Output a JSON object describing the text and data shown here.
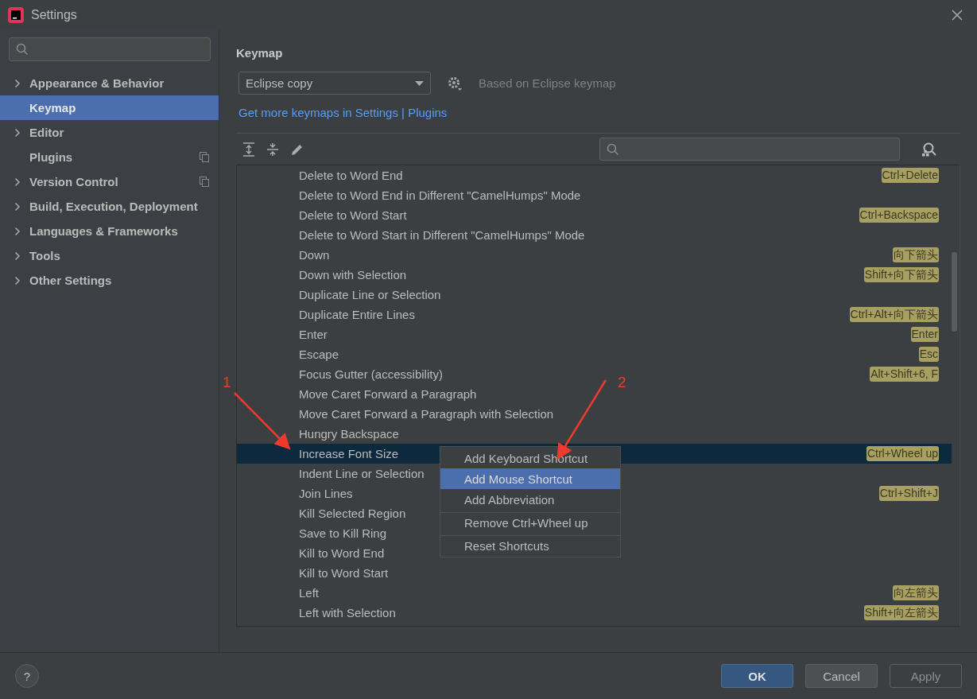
{
  "window": {
    "title": "Settings"
  },
  "sidebar": {
    "items": [
      {
        "label": "Appearance & Behavior",
        "expandable": true,
        "selected": false,
        "project_level": false
      },
      {
        "label": "Keymap",
        "expandable": false,
        "selected": true,
        "project_level": false
      },
      {
        "label": "Editor",
        "expandable": true,
        "selected": false,
        "project_level": false
      },
      {
        "label": "Plugins",
        "expandable": false,
        "selected": false,
        "project_level": true
      },
      {
        "label": "Version Control",
        "expandable": true,
        "selected": false,
        "project_level": true
      },
      {
        "label": "Build, Execution, Deployment",
        "expandable": true,
        "selected": false,
        "project_level": false
      },
      {
        "label": "Languages & Frameworks",
        "expandable": true,
        "selected": false,
        "project_level": false
      },
      {
        "label": "Tools",
        "expandable": true,
        "selected": false,
        "project_level": false
      },
      {
        "label": "Other Settings",
        "expandable": true,
        "selected": false,
        "project_level": false
      }
    ]
  },
  "page": {
    "title": "Keymap",
    "keymap_select": "Eclipse copy",
    "based_on": "Based on Eclipse keymap",
    "link": "Get more keymaps in Settings | Plugins"
  },
  "actions": [
    {
      "name": "Delete to Word End",
      "shortcut": "Ctrl+Delete",
      "selected": false
    },
    {
      "name": "Delete to Word End in Different \"CamelHumps\" Mode",
      "selected": false
    },
    {
      "name": "Delete to Word Start",
      "shortcut": "Ctrl+Backspace",
      "selected": false
    },
    {
      "name": "Delete to Word Start in Different \"CamelHumps\" Mode",
      "selected": false
    },
    {
      "name": "Down",
      "shortcut": "向下箭头",
      "selected": false
    },
    {
      "name": "Down with Selection",
      "shortcut": "Shift+向下箭头",
      "selected": false
    },
    {
      "name": "Duplicate Line or Selection",
      "selected": false
    },
    {
      "name": "Duplicate Entire Lines",
      "shortcut": "Ctrl+Alt+向下箭头",
      "selected": false
    },
    {
      "name": "Enter",
      "shortcut": "Enter",
      "selected": false
    },
    {
      "name": "Escape",
      "shortcut": "Esc",
      "selected": false
    },
    {
      "name": "Focus Gutter (accessibility)",
      "shortcut": "Alt+Shift+6, F",
      "selected": false
    },
    {
      "name": "Move Caret Forward a Paragraph",
      "selected": false
    },
    {
      "name": "Move Caret Forward a Paragraph with Selection",
      "selected": false
    },
    {
      "name": "Hungry Backspace",
      "selected": false
    },
    {
      "name": "Increase Font Size",
      "shortcut": "Ctrl+Wheel up",
      "selected": true
    },
    {
      "name": "Indent Line or Selection",
      "selected": false
    },
    {
      "name": "Join Lines",
      "shortcut": "Ctrl+Shift+J",
      "selected": false
    },
    {
      "name": "Kill Selected Region",
      "selected": false
    },
    {
      "name": "Save to Kill Ring",
      "selected": false
    },
    {
      "name": "Kill to Word End",
      "selected": false
    },
    {
      "name": "Kill to Word Start",
      "selected": false
    },
    {
      "name": "Left",
      "shortcut": "向左箭头",
      "selected": false
    },
    {
      "name": "Left with Selection",
      "shortcut": "Shift+向左箭头",
      "selected": false
    }
  ],
  "context_menu": [
    {
      "label": "Add Keyboard Shortcut",
      "selected": false,
      "separator_before": false
    },
    {
      "label": "Add Mouse Shortcut",
      "selected": true,
      "separator_before": false
    },
    {
      "label": "Add Abbreviation",
      "selected": false,
      "separator_before": false
    },
    {
      "label": "Remove Ctrl+Wheel up",
      "selected": false,
      "separator_before": true
    },
    {
      "label": "Reset Shortcuts",
      "selected": false,
      "separator_before": true
    }
  ],
  "annotations": [
    {
      "label": "1"
    },
    {
      "label": "2"
    }
  ],
  "help": {
    "label": "?"
  },
  "buttons": [
    {
      "label": "OK",
      "kind": "primary",
      "disabled": false
    },
    {
      "label": "Cancel",
      "kind": "normal",
      "disabled": false
    },
    {
      "label": "Apply",
      "kind": "normal",
      "disabled": true
    }
  ]
}
